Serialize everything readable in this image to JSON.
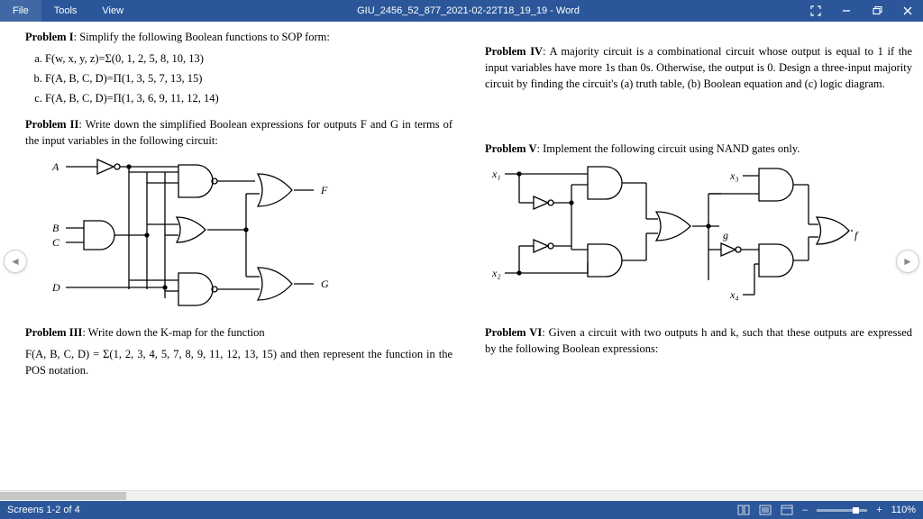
{
  "titlebar": {
    "menu": [
      "File",
      "Tools",
      "View"
    ],
    "document_title": "GIU_2456_52_877_2021-02-22T18_19_19 - Word"
  },
  "nav": {
    "prev": "◄",
    "next": "►"
  },
  "document": {
    "p1": {
      "head": "Problem I",
      "text": ": Simplify the following Boolean functions to SOP form:",
      "items": [
        "F(w, x, y, z)=Σ(0, 1, 2, 5, 8, 10, 13)",
        "F(A, B, C, D)=Π(1, 3, 5, 7, 13, 15)",
        "F(A, B, C, D)=Π(1, 3, 6, 9, 11, 12, 14)"
      ]
    },
    "p2": {
      "head": "Problem II",
      "text": ": Write down the simplified Boolean expressions for outputs F and G in terms of the input variables in the following circuit:",
      "labels": {
        "A": "A",
        "B": "B",
        "C": "C",
        "D": "D",
        "F": "F",
        "G": "G"
      }
    },
    "p3": {
      "head": "Problem III",
      "text1": ": Write down the K-map for the function",
      "text2": "F(A, B, C, D) = Σ(1, 2, 3, 4, 5, 7, 8, 9, 11, 12, 13, 15) and then represent the function in the POS notation."
    },
    "p4": {
      "head": "Problem IV",
      "text": ": A majority circuit is a combinational circuit whose output is equal to 1 if the input variables have more 1s than 0s. Otherwise, the output is 0. Design a three-input majority circuit by finding the circuit's (a) truth table, (b) Boolean equation and (c) logic diagram."
    },
    "p5": {
      "head": "Problem V",
      "text": ": Implement the following circuit using NAND gates only.",
      "labels": {
        "x1": "x₁",
        "x2": "x₂",
        "x3": "x₃",
        "x4": "x₄",
        "g": "g",
        "f": "f"
      }
    },
    "p6": {
      "head": "Problem VI",
      "text": ": Given a circuit with two outputs h and k, such that these outputs are expressed by the following Boolean expressions:"
    }
  },
  "statusbar": {
    "screens": "Screens 1-2 of 4",
    "zoom_plus": "+",
    "zoom_value": "110%"
  }
}
